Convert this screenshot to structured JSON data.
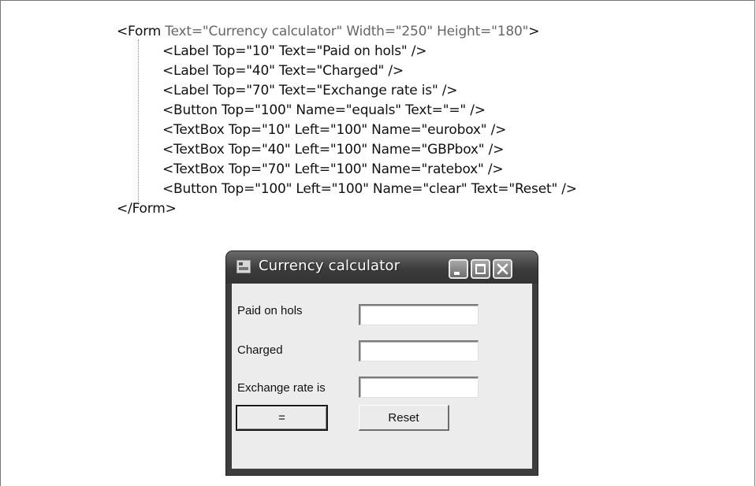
{
  "code": {
    "open_tag": "<Form",
    "open_attrs": " Text=\"Currency calculator\" Width=\"250\" Height=\"180\"",
    "open_close": ">",
    "lines": [
      "<Label Top=\"10\" Text=\"Paid on hols\" />",
      "<Label Top=\"40\" Text=\"Charged\" />",
      "<Label Top=\"70\" Text=\"Exchange rate is\" />",
      "<Button Top=\"100\" Name=\"equals\" Text=\"=\" />",
      "<TextBox Top=\"10\" Left=\"100\" Name=\"eurobox\" />",
      "<TextBox Top=\"40\" Left=\"100\" Name=\"GBPbox\" />",
      "<TextBox Top=\"70\" Left=\"100\" Name=\"ratebox\" />",
      "<Button Top=\"100\" Left=\"100\" Name=\"clear\" Text=\"Reset\" />"
    ],
    "close_tag": "</Form>"
  },
  "window": {
    "title": "Currency calculator",
    "icon": "app-window-icon",
    "controls": [
      "minimize-icon",
      "maximize-icon",
      "close-icon"
    ]
  },
  "form": {
    "labels": {
      "paid": "Paid on hols",
      "charged": "Charged",
      "rate": "Exchange rate is"
    },
    "fields": {
      "eurobox": "",
      "gbpbox": "",
      "ratebox": ""
    },
    "buttons": {
      "equals": "=",
      "reset": "Reset"
    }
  }
}
